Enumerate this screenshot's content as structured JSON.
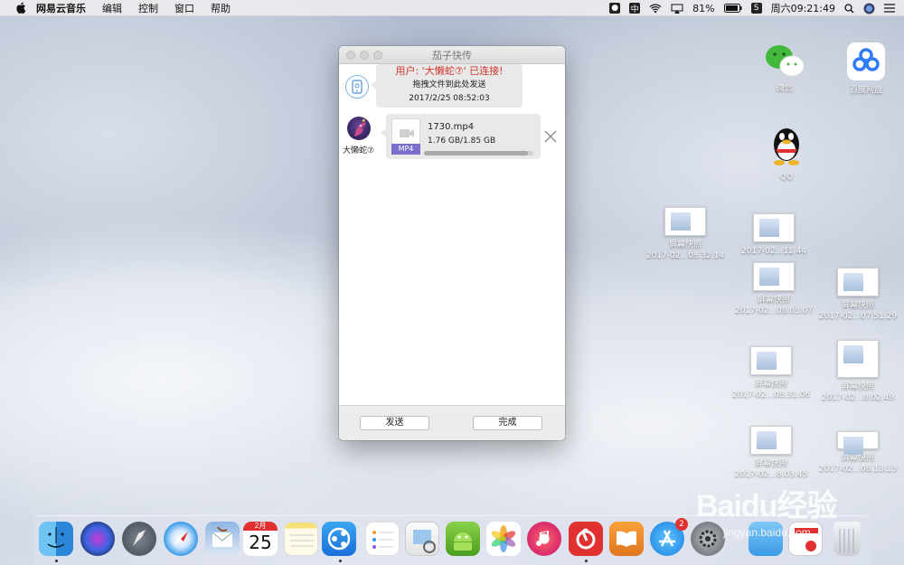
{
  "menubar": {
    "app_name": "网易云音乐",
    "items": [
      "编辑",
      "控制",
      "窗口",
      "帮助"
    ],
    "input_method": "中",
    "battery": "81%",
    "clock": "周六09:21:49"
  },
  "window": {
    "title": "茄子快传",
    "connection": {
      "status": "用户: '大懒蛇⑦' 已连接!",
      "hint": "拖拽文件到此处发送",
      "time": "2017/2/25 08:52:03"
    },
    "sender_name": "大懒蛇⑦",
    "file": {
      "type_label": "MP4",
      "name": "1730.mp4",
      "size": "1.76 GB/1.85 GB",
      "progress": 0.95
    },
    "buttons": {
      "send": "发送",
      "done": "完成"
    }
  },
  "desktop": {
    "apps": [
      {
        "label": "微信"
      },
      {
        "label": "百度网盘"
      },
      {
        "label": "QQ"
      }
    ],
    "screenshots": [
      {
        "title": "屏幕快照",
        "date": "2017-02...08.32.14"
      },
      {
        "title": "",
        "date": "2017-02...11.44"
      },
      {
        "title": "屏幕快照",
        "date": "2017-02...08.03.07"
      },
      {
        "title": "屏幕快照",
        "date": "2017-02...07.51.29"
      },
      {
        "title": "屏幕快照",
        "date": "2017-02...08.31.06"
      },
      {
        "title": "屏幕快照",
        "date": "2017-02...8.02.49"
      },
      {
        "title": "屏幕快照",
        "date": "2017-02...8.03.45"
      },
      {
        "title": "屏幕快照",
        "date": "2017-02...08.13.13"
      }
    ]
  },
  "dock": {
    "calendar_day": "25",
    "calendar_month": "2月",
    "appstore_badge": "2"
  },
  "watermark": {
    "brand": "Baidu经验",
    "url": "jingyan.baidu.com"
  },
  "colors": {
    "status_red": "#d0342c",
    "file_badge": "#7a6fcf",
    "accent_blue": "#4a90e2"
  }
}
